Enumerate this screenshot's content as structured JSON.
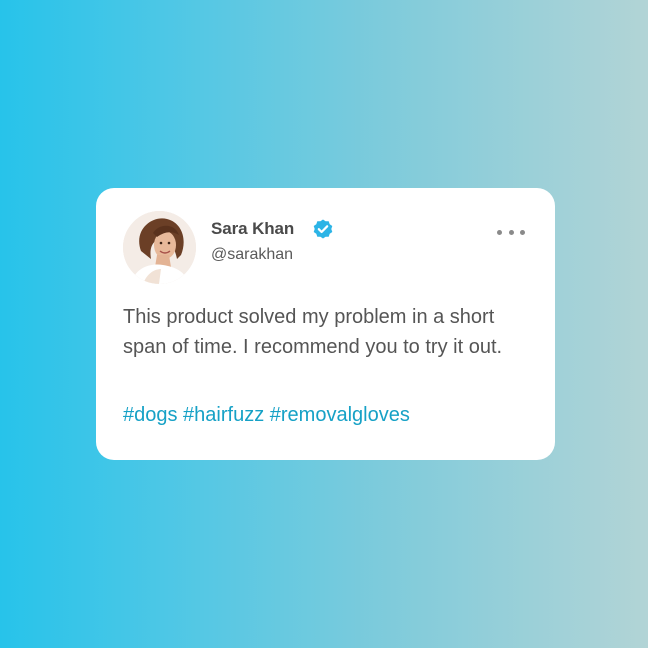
{
  "post": {
    "author": {
      "name": "Sara Khan",
      "handle": "@sarakhan",
      "verified": true,
      "avatar_icon": "profile-photo"
    },
    "more_icon": "ellipsis-horizontal-icon",
    "text": "This product solved my problem in a short span of time. I recommend you to try it out.",
    "hashtags": "#dogs #hairfuzz #removalgloves"
  },
  "colors": {
    "background_start": "#27c3ea",
    "background_end": "#b2d4d6",
    "card": "#ffffff",
    "verified_badge": "#2cb4e6",
    "hashtag": "#16a1c6",
    "text": "#555555"
  }
}
